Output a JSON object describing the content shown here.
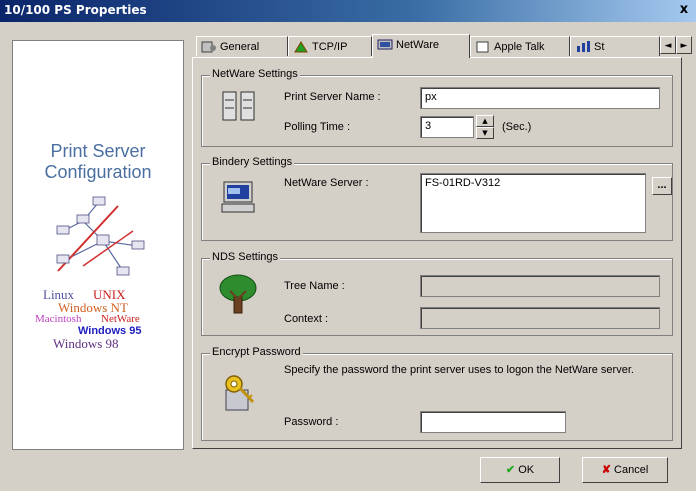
{
  "window": {
    "title": "10/100 PS Properties",
    "close_label": "x"
  },
  "left_panel": {
    "title_line1": "Print Server",
    "title_line2": "Configuration",
    "os_list": [
      "Linux",
      "UNIX",
      "Windows NT",
      "Macintosh",
      "NetWare",
      "Windows 95",
      "Windows 98"
    ]
  },
  "tabs": [
    {
      "label": "General",
      "icon": "general-icon"
    },
    {
      "label": "TCP/IP",
      "icon": "tcpip-icon"
    },
    {
      "label": "NetWare",
      "icon": "netware-icon",
      "active": true
    },
    {
      "label": "Apple Talk",
      "icon": "appletalk-icon"
    },
    {
      "label": "St",
      "icon": "status-icon"
    }
  ],
  "tab_scroll": {
    "left": "◄",
    "right": "►"
  },
  "netware_settings": {
    "group_label": "NetWare Settings",
    "print_server_name_label": "Print Server Name :",
    "print_server_name_value": "px",
    "polling_time_label": "Polling Time :",
    "polling_time_value": "3",
    "polling_unit": "(Sec.)"
  },
  "bindery_settings": {
    "group_label": "Bindery Settings",
    "netware_server_label": "NetWare Server :",
    "netware_server_value": "FS-01RD-V312",
    "browse_label": "..."
  },
  "nds_settings": {
    "group_label": "NDS Settings",
    "tree_name_label": "Tree Name :",
    "context_label": "Context :"
  },
  "encrypt_password": {
    "group_label": "Encrypt Password",
    "description": "Specify the password the print server uses to logon the NetWare server.",
    "password_label": "Password :"
  },
  "buttons": {
    "ok_label": "OK",
    "cancel_label": "Cancel"
  },
  "colors": {
    "title_bar": "#0a246a",
    "dialog_bg": "#d4d0c8",
    "panel_title": "#4a6fa0",
    "ok_check": "#22aa22",
    "cancel_x": "#cc0000"
  }
}
